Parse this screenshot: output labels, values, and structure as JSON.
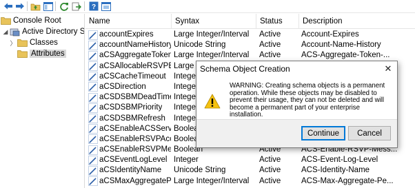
{
  "toolbar": {
    "buttons": [
      {
        "icon": "back-arrow-icon"
      },
      {
        "icon": "forward-arrow-icon"
      },
      {
        "icon": "up-folder-icon"
      },
      {
        "icon": "show-hide-tree-icon"
      },
      {
        "icon": "refresh-icon"
      },
      {
        "icon": "export-list-icon"
      },
      {
        "icon": "help-icon"
      },
      {
        "icon": "properties-icon"
      }
    ]
  },
  "tree": {
    "root": "Console Root",
    "snapin": "Active Directory Sche",
    "classes": "Classes",
    "attributes": "Attributes"
  },
  "list": {
    "columns": [
      "Name",
      "Syntax",
      "Status",
      "Description"
    ],
    "rows": [
      {
        "name": "accountExpires",
        "syntax": "Large Integer/Interval",
        "status": "Active",
        "desc": "Account-Expires"
      },
      {
        "name": "accountNameHistory",
        "syntax": "Unicode String",
        "status": "Active",
        "desc": "Account-Name-History"
      },
      {
        "name": "aCSAggregateTokenR...",
        "syntax": "Large Integer/Interval",
        "status": "Active",
        "desc": "ACS-Aggregate-Token-..."
      },
      {
        "name": "aCSAllocableRSVPBan...",
        "syntax": "Large I",
        "status": "",
        "desc": ""
      },
      {
        "name": "aCSCacheTimeout",
        "syntax": "Integer",
        "status": "",
        "desc": ""
      },
      {
        "name": "aCSDirection",
        "syntax": "Integer",
        "status": "",
        "desc": ""
      },
      {
        "name": "aCSDSBMDeadTime",
        "syntax": "Integer",
        "status": "",
        "desc": ""
      },
      {
        "name": "aCSDSBMPriority",
        "syntax": "Integer",
        "status": "",
        "desc": ""
      },
      {
        "name": "aCSDSBMRefresh",
        "syntax": "Integer",
        "status": "",
        "desc": ""
      },
      {
        "name": "aCSEnableACSService",
        "syntax": "Boolea",
        "status": "",
        "desc": ""
      },
      {
        "name": "aCSEnableRSVPAccou...",
        "syntax": "Boolea",
        "status": "",
        "desc": ""
      },
      {
        "name": "aCSEnableRSVPMessa...",
        "syntax": "Boolean",
        "status": "Active",
        "desc": "ACS-Enable-RSVP-Mess..."
      },
      {
        "name": "aCSEventLogLevel",
        "syntax": "Integer",
        "status": "Active",
        "desc": "ACS-Event-Log-Level"
      },
      {
        "name": "aCSIdentityName",
        "syntax": "Unicode String",
        "status": "Active",
        "desc": "ACS-Identity-Name"
      },
      {
        "name": "aCSMaxAggregatePea...",
        "syntax": "Large Integer/Interval",
        "status": "Active",
        "desc": "ACS-Max-Aggregate-Pe..."
      }
    ]
  },
  "dialog": {
    "title": "Schema Object Creation",
    "close": "✕",
    "message": "WARNING: Creating schema objects is a permanent operation.  While these objects may be disabled to prevent their usage, they can not be deleted and will become a permanent part of your enterprise installation.",
    "continue_label": "Continue",
    "cancel_label": "Cancel"
  },
  "colors": {
    "selection": "#d9d9d9",
    "button_focus": "#0078d7",
    "warning_yellow": "#f5c211"
  }
}
